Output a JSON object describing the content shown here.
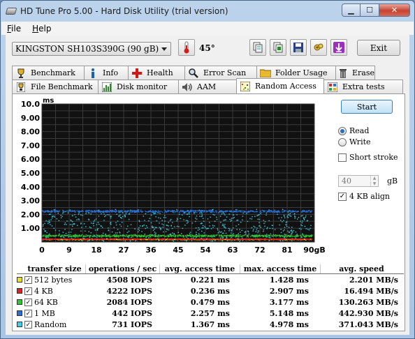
{
  "window": {
    "title": "HD Tune Pro 5.00 - Hard Disk Utility (trial version)"
  },
  "menu": {
    "file": "File",
    "help": "Help"
  },
  "toolbar": {
    "drive": "KINGSTON SH103S390G (90 gB)",
    "temperature": "45°",
    "exit_label": "Exit",
    "icons": [
      "thermometer-icon",
      "copy-info-icon",
      "copy-screenshot-icon",
      "save-icon",
      "options-icon",
      "download-icon"
    ]
  },
  "tabs_row1": [
    {
      "label": "Benchmark",
      "icon": "trophy-icon"
    },
    {
      "label": "Info",
      "icon": "info-icon"
    },
    {
      "label": "Health",
      "icon": "health-cross-icon"
    },
    {
      "label": "Error Scan",
      "icon": "magnifier-icon"
    },
    {
      "label": "Folder Usage",
      "icon": "folder-icon"
    },
    {
      "label": "Erase",
      "icon": "trash-icon"
    }
  ],
  "tabs_row2": [
    {
      "label": "File Benchmark",
      "icon": "file-benchmark-icon"
    },
    {
      "label": "Disk monitor",
      "icon": "disk-monitor-icon"
    },
    {
      "label": "AAM",
      "icon": "speaker-icon"
    },
    {
      "label": "Random Access",
      "icon": "random-access-icon"
    },
    {
      "label": "Extra tests",
      "icon": "extra-tests-icon"
    }
  ],
  "active_tab": "Random Access",
  "side": {
    "start": "Start",
    "read": "Read",
    "write": "Write",
    "read_selected": true,
    "short_stroke": "Short stroke",
    "short_stroke_checked": false,
    "stroke_value": "40",
    "gb_unit": "gB",
    "align": "4 KB align",
    "align_checked": true
  },
  "chart_data": {
    "type": "scatter",
    "ylabel": "ms",
    "xlabel": "",
    "x_unit": "gB",
    "ylim": [
      0,
      10
    ],
    "xlim": [
      0,
      90
    ],
    "y_ticks": [
      "10.0",
      "9.00",
      "8.00",
      "7.00",
      "6.00",
      "5.00",
      "4.00",
      "3.00",
      "2.00",
      "1.00"
    ],
    "x_ticks": [
      "0",
      "9",
      "18",
      "27",
      "36",
      "45",
      "54",
      "63",
      "72",
      "81",
      "90gB"
    ],
    "grid": true,
    "background": "#111111",
    "series": [
      {
        "name": "512 bytes",
        "color": "#e8e020",
        "center_ms": 0.221,
        "spread_ms": 0.05
      },
      {
        "name": "4 KB",
        "color": "#e02020",
        "center_ms": 0.236,
        "spread_ms": 0.05
      },
      {
        "name": "64 KB",
        "color": "#2ec82e",
        "center_ms": 0.479,
        "spread_ms": 0.12
      },
      {
        "name": "1 MB",
        "color": "#2a6fd8",
        "center_ms": 2.257,
        "spread_ms": 0.12
      },
      {
        "name": "Random",
        "color": "#3cd0e8",
        "center_ms": 1.367,
        "spread_ms": 0.7
      }
    ]
  },
  "results": {
    "headers": [
      "transfer size",
      "operations / sec",
      "avg. access time",
      "max. access time",
      "avg. speed"
    ],
    "rows": [
      {
        "label": "512 bytes",
        "color": "#e8e020",
        "ops": "4508 IOPS",
        "avg": "0.221 ms",
        "max": "1.428 ms",
        "speed": "2.201 MB/s"
      },
      {
        "label": "4 KB",
        "color": "#e02020",
        "ops": "4222 IOPS",
        "avg": "0.236 ms",
        "max": "2.907 ms",
        "speed": "16.494 MB/s"
      },
      {
        "label": "64 KB",
        "color": "#2ec82e",
        "ops": "2084 IOPS",
        "avg": "0.479 ms",
        "max": "3.177 ms",
        "speed": "130.263 MB/s"
      },
      {
        "label": "1 MB",
        "color": "#2a6fd8",
        "ops": "442 IOPS",
        "avg": "2.257 ms",
        "max": "5.148 ms",
        "speed": "442.930 MB/s"
      },
      {
        "label": "Random",
        "color": "#3cd0e8",
        "ops": "731 IOPS",
        "avg": "1.367 ms",
        "max": "4.978 ms",
        "speed": "371.043 MB/s"
      }
    ]
  }
}
